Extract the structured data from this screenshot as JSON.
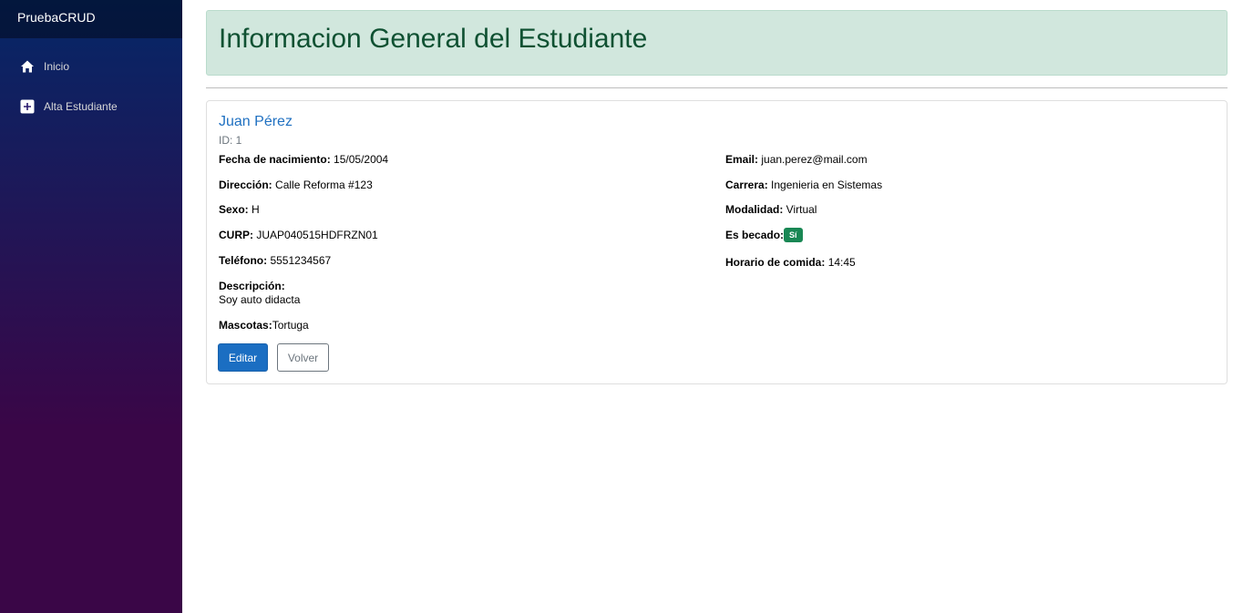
{
  "sidebar": {
    "brand": "PruebaCRUD",
    "items": [
      {
        "label": "Inicio",
        "icon": "home-icon"
      },
      {
        "label": "Alta Estudiante",
        "icon": "plus-square-icon"
      }
    ]
  },
  "header": {
    "title": "Informacion General del Estudiante"
  },
  "student": {
    "name": "Juan Pérez",
    "id_text": "ID: 1",
    "left": [
      {
        "label": "Fecha de nacimiento:",
        "value": " 15/05/2004"
      },
      {
        "label": "Dirección:",
        "value": " Calle Reforma #123"
      },
      {
        "label": "Sexo:",
        "value": " H"
      },
      {
        "label": "CURP:",
        "value": " JUAP040515HDFRZN01"
      },
      {
        "label": "Teléfono:",
        "value": " 5551234567"
      }
    ],
    "descripcion_label": "Descripción:",
    "descripcion_value": "Soy auto didacta",
    "mascotas_label": "Mascotas:",
    "mascotas_value": "Tortuga",
    "right": [
      {
        "label": "Email:",
        "value": " juan.perez@mail.com"
      },
      {
        "label": "Carrera:",
        "value": " Ingenieria en Sistemas"
      },
      {
        "label": "Modalidad:",
        "value": " Virtual"
      },
      {
        "label": "Es becado:",
        "badge": "Sí"
      },
      {
        "label": "Horario de comida:",
        "value": " 14:45"
      }
    ]
  },
  "actions": {
    "edit_label": "Editar",
    "back_label": "Volver"
  },
  "colors": {
    "sidebar_top": "#052767",
    "sidebar_bottom": "#3a0647",
    "header_bg": "#d1e7dd",
    "header_text": "#0f5132",
    "link": "#1f70c1",
    "badge_success": "#198754",
    "primary_button": "#1b6ec2"
  }
}
